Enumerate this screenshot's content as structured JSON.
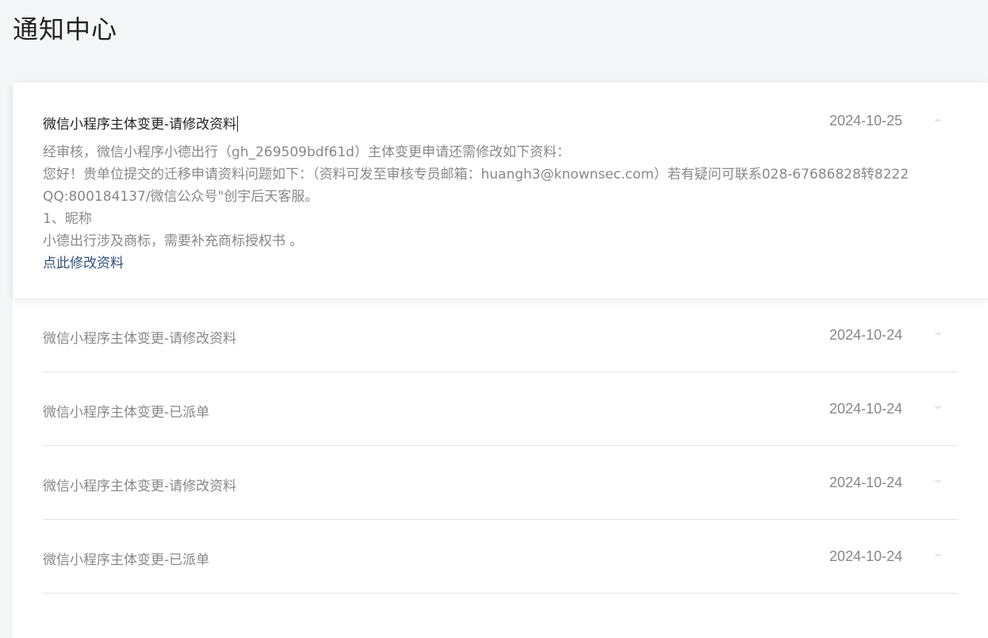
{
  "page": {
    "title": "通知中心"
  },
  "expanded": {
    "title": "微信小程序主体变更-请修改资料",
    "date": "2024-10-25",
    "body_lines": [
      "经审核，微信小程序小德出行（gh_269509bdf61d）主体变更申请还需修改如下资料：",
      "您好！贵单位提交的迁移申请资料问题如下：（资料可发至审核专员邮箱：huangh3@knownsec.com）若有疑问可联系028-67686828转8222 QQ:800184137/微信公众号\"创宇后天客服。",
      "1、昵称",
      "小德出行涉及商标，需要补充商标授权书 。"
    ],
    "link_label": "点此修改资料"
  },
  "notifications": [
    {
      "title": "微信小程序主体变更-请修改资料",
      "date": "2024-10-24"
    },
    {
      "title": "微信小程序主体变更-已派单",
      "date": "2024-10-24"
    },
    {
      "title": "微信小程序主体变更-请修改资料",
      "date": "2024-10-24"
    },
    {
      "title": "微信小程序主体变更-已派单",
      "date": "2024-10-24"
    }
  ],
  "icons": {
    "collapse": "chevron-up-icon",
    "expand": "chevron-down-icon"
  },
  "colors": {
    "link": "#33507c",
    "muted": "#888888",
    "title": "#222222"
  }
}
